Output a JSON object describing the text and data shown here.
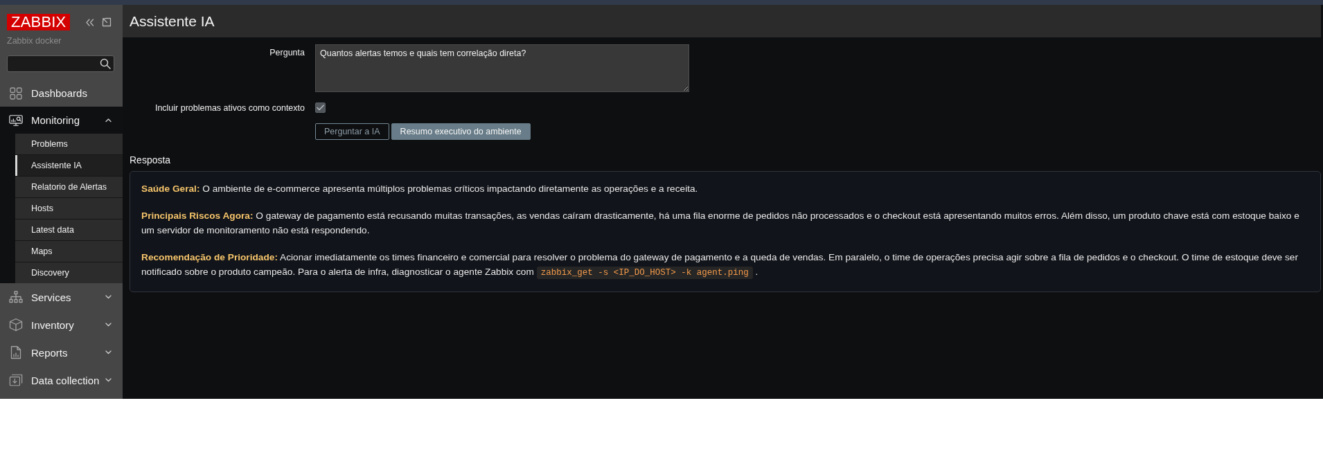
{
  "sidebar": {
    "logo": "ZABBIX",
    "server_name": "Zabbix docker",
    "items": [
      {
        "label": "Dashboards",
        "kind": "link"
      },
      {
        "label": "Monitoring",
        "kind": "menu",
        "expanded": true,
        "children": [
          {
            "label": "Problems",
            "selected": false
          },
          {
            "label": "Assistente IA",
            "selected": true
          },
          {
            "label": "Relatorio de Alertas",
            "selected": false
          },
          {
            "label": "Hosts",
            "selected": false
          },
          {
            "label": "Latest data",
            "selected": false
          },
          {
            "label": "Maps",
            "selected": false
          },
          {
            "label": "Discovery",
            "selected": false
          }
        ]
      },
      {
        "label": "Services",
        "kind": "menu",
        "expanded": false
      },
      {
        "label": "Inventory",
        "kind": "menu",
        "expanded": false
      },
      {
        "label": "Reports",
        "kind": "menu",
        "expanded": false
      },
      {
        "label": "Data collection",
        "kind": "menu",
        "expanded": false
      }
    ]
  },
  "page": {
    "title": "Assistente IA"
  },
  "form": {
    "question_label": "Pergunta",
    "question": "Quantos alertas temos e quais tem correlação direta?",
    "context_option": {
      "label": "Incluir problemas ativos como contexto",
      "checked": true
    },
    "buttons": [
      {
        "label": "Perguntar a IA",
        "kind": "secondary"
      },
      {
        "label": "Resumo executivo do ambiente",
        "kind": "primary"
      }
    ]
  },
  "response": {
    "heading": "Resposta",
    "paragraphs": [
      {
        "text": "**Saúde Geral:** O ambiente de e-commerce apresenta múltiplos problemas críticos impactando diretamente as operações e a receita."
      },
      {
        "text": "**Principais Riscos Agora:** O gateway de pagamento está recusando muitas transações, as vendas caíram drasticamente, há uma fila enorme de pedidos não processados e o checkout está apresentando muitos erros. Além disso, um produto chave está com estoque baixo e um servidor de monitoramento não está respondendo."
      },
      {
        "text": "**Recomendação de Prioridade:** Acionar imediatamente os times financeiro e comercial para resolver o problema do gateway de pagamento e a queda de vendas. Em paralelo, o time de operações precisa agir sobre a fila de pedidos e o checkout. O time de estoque deve ser notificado sobre o produto campeão. Para o alerta de infra, diagnosticar o agente Zabbix com",
        "code": "zabbix_get -s <IP_DO_HOST> -k agent.ping",
        "tail": "."
      }
    ]
  }
}
